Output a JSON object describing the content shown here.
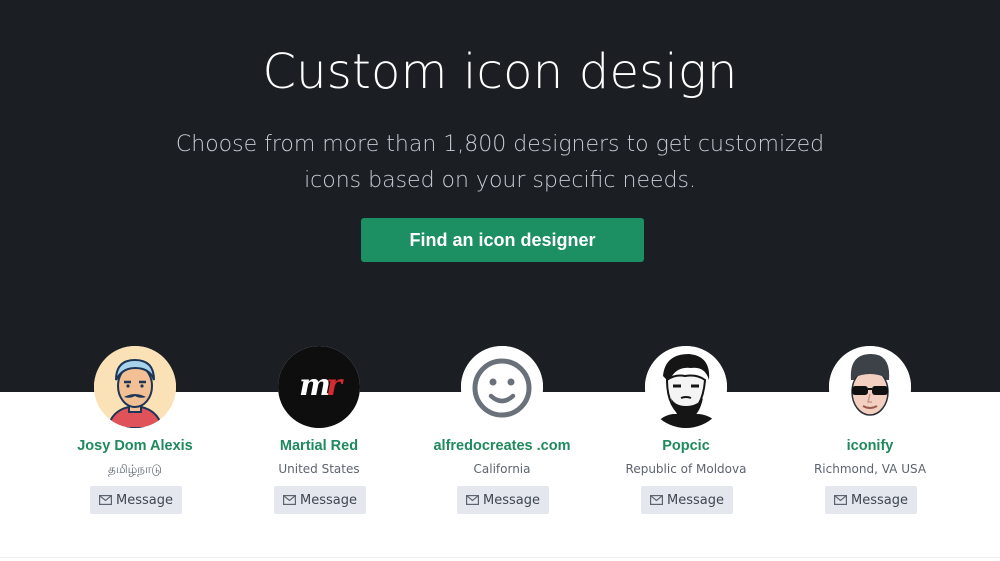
{
  "hero": {
    "title": "Custom icon design",
    "subtitle_line1": "Choose from more than 1,800 designers to get customized",
    "subtitle_line2": "icons based on your specific needs.",
    "cta_label": "Find an icon designer",
    "background": "#1b1f24",
    "accent": "#1c8f63"
  },
  "designers": [
    {
      "name": "Josy Dom Alexis",
      "location": "தமிழ்நாடு",
      "message_label": "Message",
      "avatar_icon": "mustache-man-avatar"
    },
    {
      "name": "Martial Red",
      "location": "United States",
      "message_label": "Message",
      "avatar_icon": "mr-logo-avatar"
    },
    {
      "name": "alfredocreates .com",
      "location": "California",
      "message_label": "Message",
      "avatar_icon": "smiley-face-avatar"
    },
    {
      "name": "Popcic",
      "location": "Republic of Moldova",
      "message_label": "Message",
      "avatar_icon": "bearded-man-avatar"
    },
    {
      "name": "iconify",
      "location": "Richmond, VA USA",
      "message_label": "Message",
      "avatar_icon": "sunglasses-man-avatar"
    }
  ]
}
